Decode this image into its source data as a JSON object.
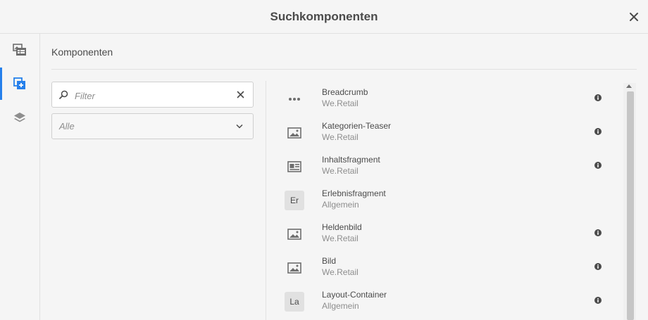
{
  "dialog": {
    "title": "Suchkomponenten",
    "close_icon": "close-icon"
  },
  "rail": {
    "buttons": [
      {
        "icon": "assets-icon",
        "active": false
      },
      {
        "icon": "components-icon",
        "active": true
      },
      {
        "icon": "layers-icon",
        "active": false
      }
    ],
    "accent_color": "#2680eb"
  },
  "panel": {
    "title": "Komponenten",
    "filter": {
      "placeholder": "Filter",
      "value": ""
    },
    "group_select": {
      "selected": "Alle"
    }
  },
  "components": [
    {
      "name": "Breadcrumb",
      "group": "We.Retail",
      "icon": "more-icon",
      "has_info": true
    },
    {
      "name": "Kategorien-Teaser",
      "group": "We.Retail",
      "icon": "image-icon",
      "has_info": true
    },
    {
      "name": "Inhaltsfragment",
      "group": "We.Retail",
      "icon": "content-fragment-icon",
      "has_info": true
    },
    {
      "name": "Erlebnisfragment",
      "group": "Allgemein",
      "abbr": "Er",
      "has_info": false
    },
    {
      "name": "Heldenbild",
      "group": "We.Retail",
      "icon": "image-icon",
      "has_info": true
    },
    {
      "name": "Bild",
      "group": "We.Retail",
      "icon": "image-icon",
      "has_info": true
    },
    {
      "name": "Layout-Container",
      "group": "Allgemein",
      "abbr": "La",
      "has_info": true
    }
  ]
}
